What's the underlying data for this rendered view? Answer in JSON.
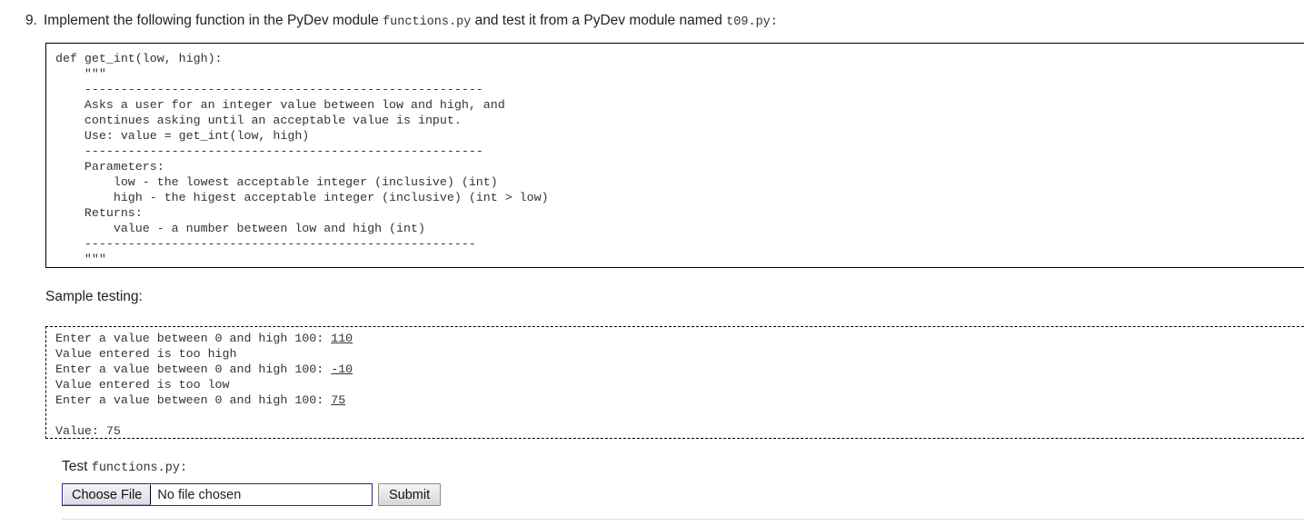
{
  "question": {
    "number": "9.",
    "text_before_module": "Implement the following function in the PyDev module",
    "module_name": "functions.py",
    "text_middle": "and test it from a PyDev module named",
    "test_module_name": "t09.py:"
  },
  "function_spec": {
    "code": "def get_int(low, high):\n    \"\"\"\n    -------------------------------------------------------\n    Asks a user for an integer value between low and high, and\n    continues asking until an acceptable value is input.\n    Use: value = get_int(low, high)\n    -------------------------------------------------------\n    Parameters:\n        low - the lowest acceptable integer (inclusive) (int)\n        high - the higest acceptable integer (inclusive) (int > low)\n    Returns:\n        value - a number between low and high (int)\n    ------------------------------------------------------\n    \"\"\""
  },
  "sample": {
    "heading": "Sample testing:",
    "lines": [
      {
        "prompt": "Enter a value between 0 and high 100: ",
        "input": "110"
      },
      {
        "prompt": "Value entered is too high",
        "input": ""
      },
      {
        "prompt": "Enter a value between 0 and high 100: ",
        "input": "-10"
      },
      {
        "prompt": "Value entered is too low",
        "input": ""
      },
      {
        "prompt": "Enter a value between 0 and high 100: ",
        "input": "75"
      },
      {
        "prompt": "",
        "input": ""
      },
      {
        "prompt": "Value: 75",
        "input": ""
      }
    ]
  },
  "form": {
    "label_prefix": "Test ",
    "label_file": "functions.py:",
    "choose_file_label": "Choose File",
    "file_status": "No file chosen",
    "submit_label": "Submit",
    "accent_border": "#2b2b8f"
  }
}
